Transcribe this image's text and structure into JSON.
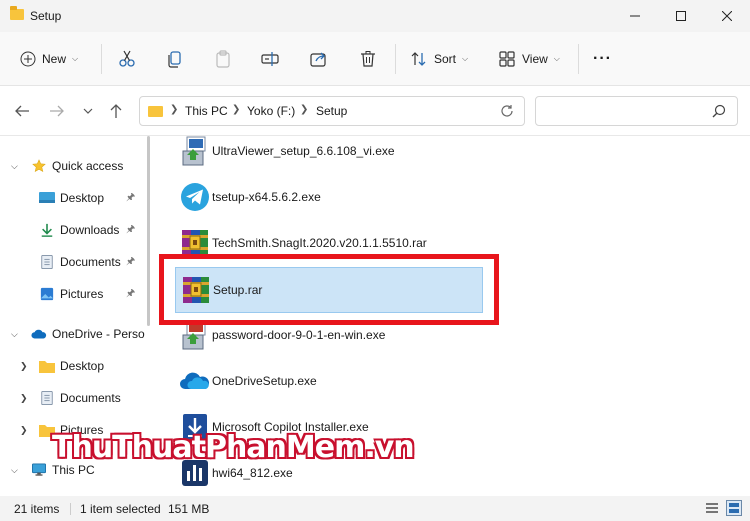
{
  "window": {
    "title": "Setup"
  },
  "toolbar": {
    "new_label": "New",
    "sort_label": "Sort",
    "view_label": "View",
    "more_label": "···"
  },
  "address": {
    "crumbs": [
      "This PC",
      "Yoko (F:)",
      "Setup"
    ],
    "search_placeholder": ""
  },
  "sidebar": {
    "items": [
      {
        "label": "Quick access",
        "icon": "star-icon"
      },
      {
        "label": "Desktop",
        "icon": "desktop-icon"
      },
      {
        "label": "Downloads",
        "icon": "download-icon"
      },
      {
        "label": "Documents",
        "icon": "documents-icon"
      },
      {
        "label": "Pictures",
        "icon": "pictures-icon"
      },
      {
        "label": "OneDrive - Perso",
        "icon": "cloud-icon"
      },
      {
        "label": "Desktop",
        "icon": "folder-icon"
      },
      {
        "label": "Documents",
        "icon": "documents-icon"
      },
      {
        "label": "Pictures",
        "icon": "folder-icon"
      },
      {
        "label": "This PC",
        "icon": "monitor-icon"
      }
    ]
  },
  "files": [
    {
      "name": "UltraViewer_setup_6.6.108_vi.exe",
      "icon": "installer-icon"
    },
    {
      "name": "tsetup-x64.5.6.2.exe",
      "icon": "telegram-icon"
    },
    {
      "name": "TechSmith.SnagIt.2020.v20.1.1.5510.rar",
      "icon": "winrar-icon"
    },
    {
      "name": "Setup.rar",
      "icon": "winrar-icon",
      "selected": true
    },
    {
      "name": "password-door-9-0-1-en-win.exe",
      "icon": "installer-icon"
    },
    {
      "name": "OneDriveSetup.exe",
      "icon": "onedrive-icon"
    },
    {
      "name": "Microsoft Copilot Installer.exe",
      "icon": "download-installer-icon"
    },
    {
      "name": "hwi64_812.exe",
      "icon": "hwinfo-icon"
    }
  ],
  "watermark": {
    "part1": "ThuThuat",
    "part2": "PhanMem",
    "part3": ".vn"
  },
  "status": {
    "count": "21 items",
    "selection": "1 item selected",
    "size": "151 MB"
  },
  "colors": {
    "accent": "#0067c0",
    "selection_bg": "#cce4f7",
    "highlight_border": "#e8151c"
  }
}
